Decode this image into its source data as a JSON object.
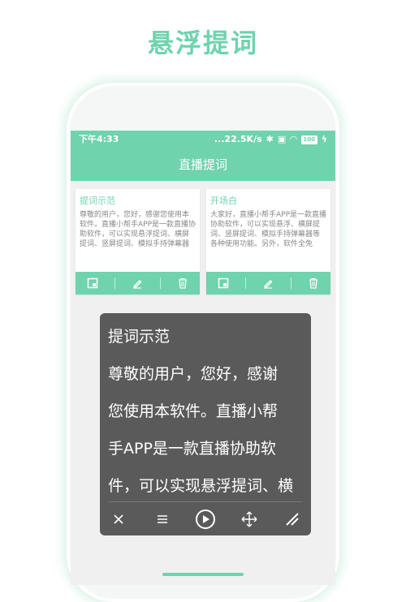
{
  "hero_title": "悬浮提词",
  "status": {
    "time": "下午4:33",
    "network": "...22.5K/s",
    "battery": "100"
  },
  "appbar": {
    "title": "直播提词"
  },
  "cards": [
    {
      "title": "提词示范",
      "body": "尊敬的用户，您好，感谢您使用本软件。直播小帮手APP是一款直播协助软件，可以实现悬浮提词、横屏提词、竖屏提词、模拟手持弹幕器等各"
    },
    {
      "title": "开场白",
      "body": "大家好，直播小帮手APP是一款直播协助软件，可以实现悬浮、横屏提词、竖屏提词、模拟手持弹幕器等各种使用功能。另外，软件全免费，无"
    }
  ],
  "float_panel": {
    "lines": [
      "提词示范",
      "尊敬的用户，您好，感谢",
      "您使用本软件。直播小帮",
      "手APP是一款直播协助软",
      "件，可以实现悬浮提词、横"
    ]
  },
  "colors": {
    "accent": "#6fd3ad",
    "panel": "#5a5a5a"
  }
}
